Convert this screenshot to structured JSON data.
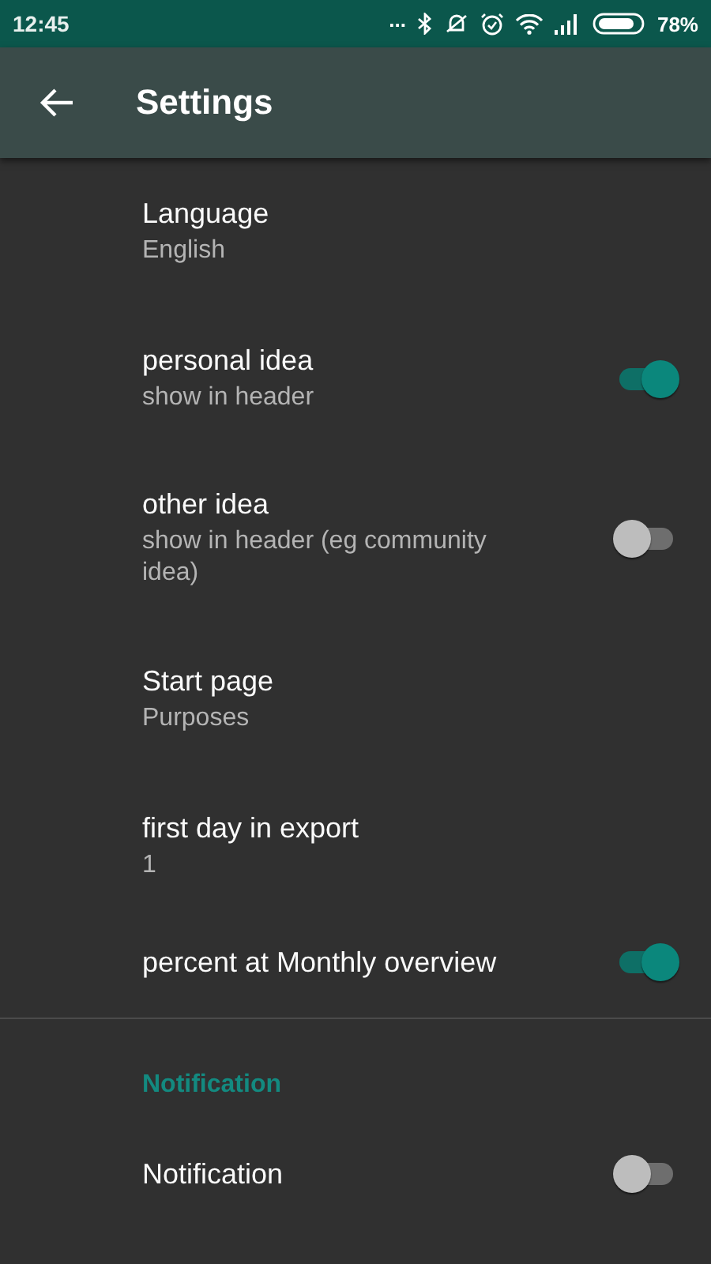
{
  "status_bar": {
    "time": "12:45",
    "dots": "...",
    "battery_percent": "78%"
  },
  "app_bar": {
    "title": "Settings"
  },
  "settings": [
    {
      "kind": "item",
      "title": "Language",
      "summary": "English"
    },
    {
      "kind": "switch",
      "title": "personal idea",
      "summary": "show in header",
      "on": true
    },
    {
      "kind": "switch",
      "title": "other idea",
      "summary": "show in header (eg community idea)",
      "on": false
    },
    {
      "kind": "item",
      "title": "Start page",
      "summary": "Purposes"
    },
    {
      "kind": "item",
      "title": "first day in export",
      "summary": "1"
    },
    {
      "kind": "switch",
      "title": "percent at Monthly overview",
      "on": true
    },
    {
      "kind": "divider"
    },
    {
      "kind": "category",
      "title": "Notification"
    },
    {
      "kind": "switch",
      "title": "Notification",
      "on": false
    }
  ]
}
